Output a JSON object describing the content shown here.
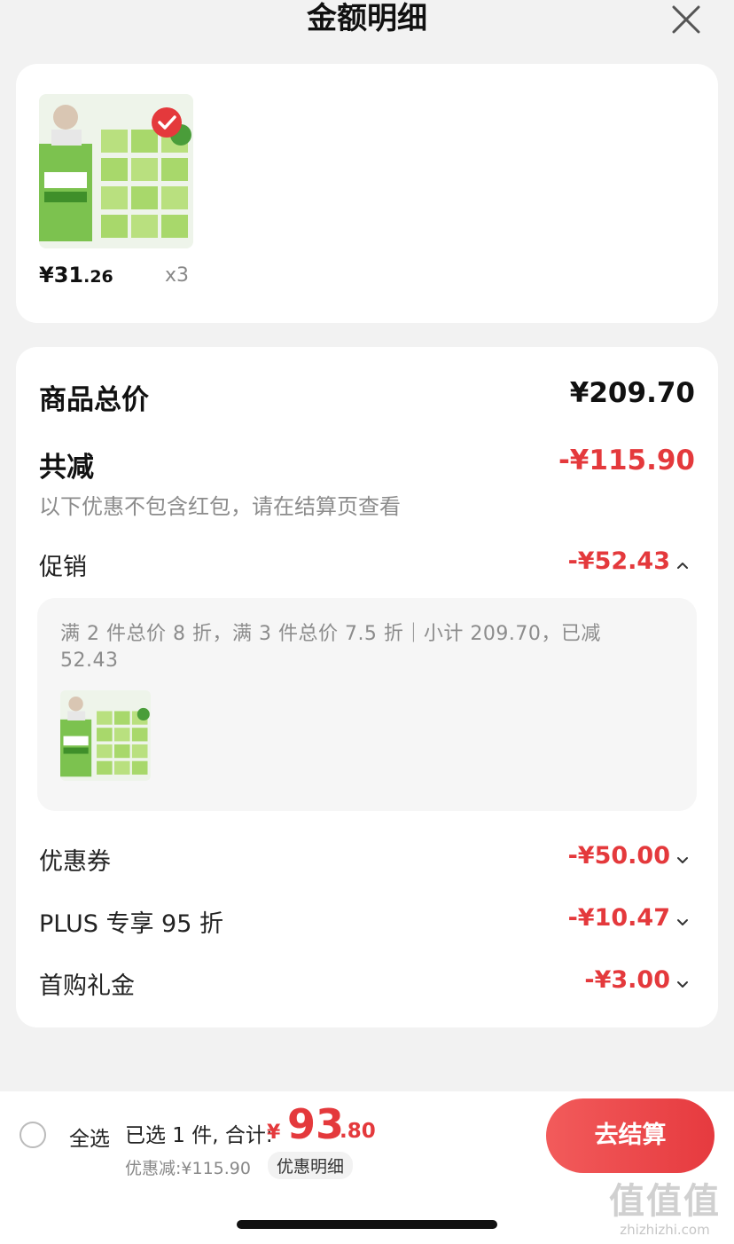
{
  "header": {
    "title": "金额明细"
  },
  "product": {
    "price_int": "¥31",
    "price_cents": ".26",
    "quantity": "x3",
    "image_icon": "product-thumbnail-image"
  },
  "summary": {
    "total_label": "商品总价",
    "total_value": "¥209.70",
    "reduced_label": "共减",
    "reduced_value": "-¥115.90",
    "note": "以下优惠不包含红包，请在结算页查看",
    "promo_label": "促销",
    "promo_value": "-¥52.43",
    "promo_detail": "满 2 件总价 8 折，满 3 件总价 7.5 折｜小计 209.70，已减 52.43",
    "coupon_label": "优惠券",
    "coupon_value": "-¥50.00",
    "plus_label": "PLUS 专享 95 折",
    "plus_value": "-¥10.47",
    "gift_label": "首购礼金",
    "gift_value": "-¥3.00"
  },
  "bottom": {
    "select_all": "全选",
    "selected_info": "已选 1 件, 合计:",
    "total_currency": "¥",
    "total_int": "93",
    "total_cents": ".80",
    "discount_line": "优惠减:¥115.90",
    "detail_link": "优惠明细",
    "checkout": "去结算"
  },
  "watermark": {
    "logo": "值值值",
    "url": "zhizhizhi.com"
  },
  "colors": {
    "accent_red": "#e4393c",
    "check_red": "#e4393c",
    "background": "#f2f2f2"
  }
}
